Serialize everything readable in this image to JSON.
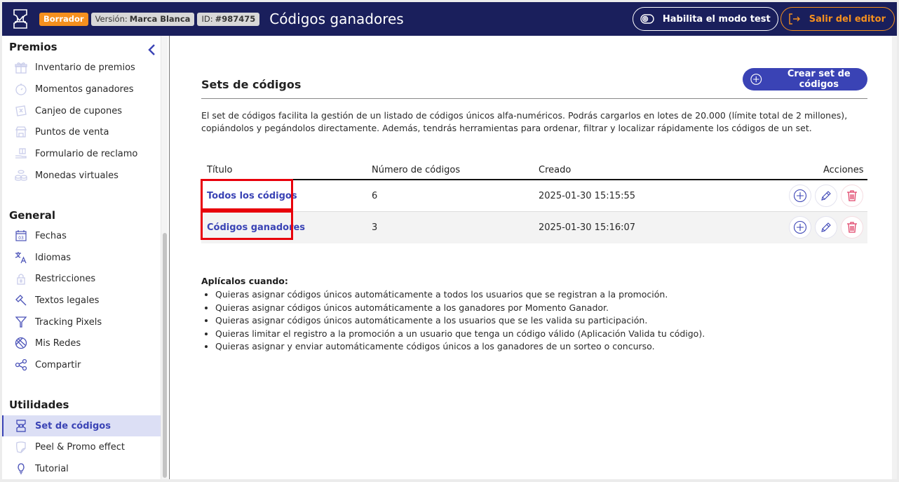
{
  "header": {
    "status_badge": "Borrador",
    "version_label": "Versión:",
    "version_value": "Marca Blanca",
    "id_label": "ID:",
    "id_value": "#987475",
    "title": "Códigos ganadores",
    "test_mode_button": "Habilita el modo test",
    "exit_button": "Salir del editor"
  },
  "sidebar": {
    "sections": [
      {
        "title": "Premios",
        "items": [
          {
            "label": "Inventario de premios",
            "icon": "gift-icon"
          },
          {
            "label": "Momentos ganadores",
            "icon": "stopwatch-icon"
          },
          {
            "label": "Canjeo de cupones",
            "icon": "coupon-icon"
          },
          {
            "label": "Puntos de venta",
            "icon": "store-icon"
          },
          {
            "label": "Formulario de reclamo",
            "icon": "hand-gift-icon"
          },
          {
            "label": "Monedas virtuales",
            "icon": "coins-icon"
          }
        ]
      },
      {
        "title": "General",
        "items": [
          {
            "label": "Fechas",
            "icon": "calendar-icon"
          },
          {
            "label": "Idiomas",
            "icon": "translate-icon"
          },
          {
            "label": "Restricciones",
            "icon": "lock-icon"
          },
          {
            "label": "Textos legales",
            "icon": "gavel-icon"
          },
          {
            "label": "Tracking Pixels",
            "icon": "filter-icon"
          },
          {
            "label": "Mis Redes",
            "icon": "network-globe-icon"
          },
          {
            "label": "Compartir",
            "icon": "share-icon"
          }
        ]
      },
      {
        "title": "Utilidades",
        "items": [
          {
            "label": "Set de códigos",
            "icon": "ticket-icon",
            "active": true
          },
          {
            "label": "Peel & Promo effect",
            "icon": "peel-icon"
          },
          {
            "label": "Tutorial",
            "icon": "lightbulb-icon"
          }
        ]
      }
    ]
  },
  "main": {
    "heading": "Sets de códigos",
    "create_button": "Crear set de códigos",
    "description": "El set de códigos facilita la gestión de un listado de códigos únicos alfa-numéricos. Podrás cargarlos en lotes de 20.000 (límite total de 2 millones), copiándolos y pegándolos directamente. Además, tendrás herramientas para ordenar, filtrar y localizar rápidamente los códigos de un set.",
    "table": {
      "columns": [
        "Título",
        "Número de códigos",
        "Creado",
        "Acciones"
      ],
      "rows": [
        {
          "title": "Todos los códigos",
          "count": "6",
          "created": "2025-01-30 15:15:55"
        },
        {
          "title": "Códigos ganadores",
          "count": "3",
          "created": "2025-01-30 15:16:07"
        }
      ]
    },
    "apply_title": "Aplícalos cuando:",
    "apply_items": [
      "Quieras asignar códigos únicos automáticamente a todos los usuarios que se registran a la promoción.",
      "Quieras asignar códigos únicos automáticamente a los ganadores por Momento Ganador.",
      "Quieras asignar códigos únicos automáticamente a los usuarios que se les valida su participación.",
      "Quieras limitar el registro a la promoción a un usuario que tenga un código válido (Aplicación Valida tu código).",
      "Quieras asignar y enviar automáticamente códigos únicos a los ganadores de un sorteo o concurso."
    ]
  },
  "colors": {
    "header_bg": "#1a1f5c",
    "accent": "#3a43b5",
    "draft_orange": "#f5901e",
    "highlight_red": "#e8000b",
    "delete_red": "#e0456a"
  }
}
